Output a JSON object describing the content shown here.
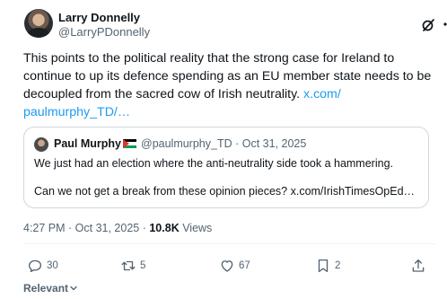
{
  "author": {
    "name": "Larry Donnelly",
    "handle": "@LarryPDonnelly"
  },
  "post": {
    "text": "This points to the political reality that the strong case for Ireland to continue to up its defence spending as an EU member state needs to be decoupled from the sacred cow of Irish neutrality.",
    "link": "x.com/ paulmurphy_TD/…"
  },
  "quote": {
    "name": "Paul Murphy",
    "meta": "@paulmurphy_TD · Oct 31, 2025",
    "line1": "We just had an election where the anti-neutrality side took a hammering.",
    "line2": "Can we not get a break from these opinion pieces? x.com/IrishTimesOpEd…"
  },
  "meta": {
    "time_date": "4:27 PM · Oct 31, 2025 · ",
    "views_count": "10.8K",
    "views_label": " Views"
  },
  "actions": {
    "replies": "30",
    "reposts": "5",
    "likes": "67",
    "bookmarks": "2"
  },
  "sort": {
    "label": "Relevant"
  },
  "icons": {
    "grok": "grok-icon",
    "more": "more-icon",
    "reply": "reply-icon",
    "repost": "repost-icon",
    "like": "heart-icon",
    "bookmark": "bookmark-icon",
    "share": "share-icon",
    "chevron": "chevron-down-icon"
  },
  "colors": {
    "link": "#1d9bf0",
    "secondary_text": "#536471",
    "primary_text": "#0f1419",
    "border": "#cfd9de"
  }
}
